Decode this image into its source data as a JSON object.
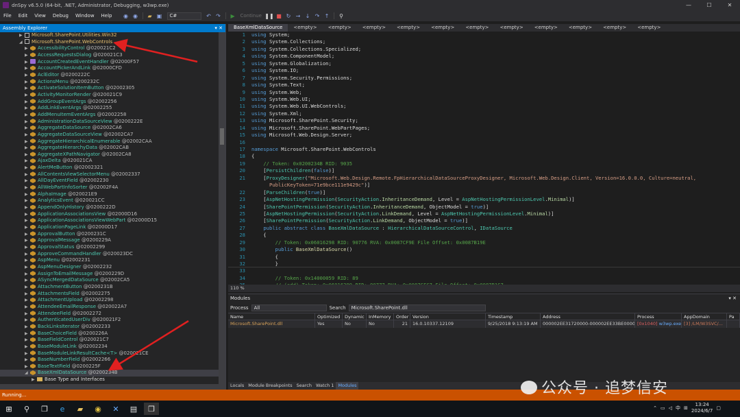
{
  "window": {
    "title": "dnSpy v6.5.0 (64-bit, .NET, Administrator, Debugging, w3wp.exe)"
  },
  "menu": [
    "File",
    "Edit",
    "View",
    "Debug",
    "Window",
    "Help"
  ],
  "toolbar": {
    "language": "C#",
    "continue_label": "Continue"
  },
  "explorer": {
    "header": "Assembly Explorer",
    "items": [
      {
        "kind": "ns",
        "exp": "▶",
        "name": "Microsoft.SharePoint.Utilities.Win32",
        "token": ""
      },
      {
        "kind": "ns",
        "exp": "◢",
        "name": "Microsoft.SharePoint.WebControls",
        "token": ""
      },
      {
        "kind": "class",
        "exp": "▶",
        "name": "AccessibilityControl",
        "token": "@020021C2"
      },
      {
        "kind": "class",
        "exp": "▶",
        "name": "AccessRequestsDialog",
        "token": "@020021C3"
      },
      {
        "kind": "delegate",
        "exp": "▶",
        "name": "AccountCreatedEventHandler",
        "token": "@02000F57"
      },
      {
        "kind": "class",
        "exp": "▶",
        "name": "AccountPickerAndLink",
        "token": "@02000CFD"
      },
      {
        "kind": "class",
        "exp": "▶",
        "name": "AclEditor",
        "token": "@0200222C"
      },
      {
        "kind": "class",
        "exp": "▶",
        "name": "ActionsMenu",
        "token": "@0200232C"
      },
      {
        "kind": "class",
        "exp": "▶",
        "name": "ActivateSolutionItemButton",
        "token": "@02002305"
      },
      {
        "kind": "class",
        "exp": "▶",
        "name": "ActivityMonitorRender",
        "token": "@020021C9"
      },
      {
        "kind": "class",
        "exp": "▶",
        "name": "AddGroupEventArgs",
        "token": "@02002256"
      },
      {
        "kind": "class",
        "exp": "▶",
        "name": "AddLinkEventArgs",
        "token": "@02002255"
      },
      {
        "kind": "class",
        "exp": "▶",
        "name": "AddMenuItemEventArgs",
        "token": "@02002258"
      },
      {
        "kind": "class",
        "exp": "▶",
        "name": "AdministrationDataSourceView",
        "token": "@0200222E"
      },
      {
        "kind": "class",
        "exp": "▶",
        "name": "AggregateDataSource",
        "token": "@02002CA6"
      },
      {
        "kind": "class",
        "exp": "▶",
        "name": "AggregateDataSourceView",
        "token": "@02002CA7"
      },
      {
        "kind": "class",
        "exp": "▶",
        "name": "AggregateHierarchicalEnumerable",
        "token": "@02002CAA"
      },
      {
        "kind": "class",
        "exp": "▶",
        "name": "AggregateHierarchyData",
        "token": "@02002CAB"
      },
      {
        "kind": "class",
        "exp": "▶",
        "name": "AggregateXPathNavigator",
        "token": "@02002CA8"
      },
      {
        "kind": "class",
        "exp": "▶",
        "name": "AjaxDelta",
        "token": "@020021CA"
      },
      {
        "kind": "class",
        "exp": "▶",
        "name": "AlertMeButton",
        "token": "@02002321"
      },
      {
        "kind": "class",
        "exp": "▶",
        "name": "AllContentsViewSelectorMenu",
        "token": "@02002337"
      },
      {
        "kind": "class",
        "exp": "▶",
        "name": "AllDayEventField",
        "token": "@02002230"
      },
      {
        "kind": "class",
        "exp": "▶",
        "name": "AllWebPartInfoSorter",
        "token": "@02002F4A"
      },
      {
        "kind": "class",
        "exp": "▶",
        "name": "AlphaImage",
        "token": "@020021E9"
      },
      {
        "kind": "class",
        "exp": "▶",
        "name": "AnalyticsEvent",
        "token": "@020021CC"
      },
      {
        "kind": "class",
        "exp": "▶",
        "name": "AppendOnlyHistory",
        "token": "@0200222D"
      },
      {
        "kind": "class",
        "exp": "▶",
        "name": "ApplicationAssociationsView",
        "token": "@02000D16"
      },
      {
        "kind": "class",
        "exp": "▶",
        "name": "ApplicationAssociationsViewWebPart",
        "token": "@02000D15"
      },
      {
        "kind": "class",
        "exp": "▶",
        "name": "ApplicationPageLink",
        "token": "@02000D17"
      },
      {
        "kind": "class",
        "exp": "▶",
        "name": "ApprovalButton",
        "token": "@0200231C"
      },
      {
        "kind": "class",
        "exp": "▶",
        "name": "ApprovalMessage",
        "token": "@0200229A"
      },
      {
        "kind": "class",
        "exp": "▶",
        "name": "ApprovalStatus",
        "token": "@02002299"
      },
      {
        "kind": "class",
        "exp": "▶",
        "name": "ApproveCommandHandler",
        "token": "@020023DC"
      },
      {
        "kind": "class",
        "exp": "▶",
        "name": "AspMenu",
        "token": "@02002231"
      },
      {
        "kind": "class",
        "exp": "▶",
        "name": "AspMenuDesigner",
        "token": "@02002232"
      },
      {
        "kind": "class",
        "exp": "▶",
        "name": "AssignToEmailMessage",
        "token": "@0200229D"
      },
      {
        "kind": "class",
        "exp": "▶",
        "name": "ASyncMergedDataSource",
        "token": "@02002CA5"
      },
      {
        "kind": "class",
        "exp": "▶",
        "name": "AttachmentButton",
        "token": "@0200231B"
      },
      {
        "kind": "class",
        "exp": "▶",
        "name": "AttachmentsField",
        "token": "@02002275"
      },
      {
        "kind": "class",
        "exp": "▶",
        "name": "AttachmentUpload",
        "token": "@02002298"
      },
      {
        "kind": "class",
        "exp": "▶",
        "name": "AttendeeEmailResponse",
        "token": "@020022A7"
      },
      {
        "kind": "class",
        "exp": "▶",
        "name": "AttendeeField",
        "token": "@02002272"
      },
      {
        "kind": "class",
        "exp": "▶",
        "name": "AuthenticatedUserDiv",
        "token": "@020021F2"
      },
      {
        "kind": "class",
        "exp": "▶",
        "name": "BackLinksIterator",
        "token": "@02002233"
      },
      {
        "kind": "class",
        "exp": "▶",
        "name": "BaseChoiceField",
        "token": "@0200226A"
      },
      {
        "kind": "class",
        "exp": "▶",
        "name": "BaseFieldControl",
        "token": "@020021C7"
      },
      {
        "kind": "class",
        "exp": "▶",
        "name": "BaseModuleLink",
        "token": "@02002234"
      },
      {
        "kind": "class",
        "exp": "▶",
        "name": "BaseModuleLinkResultCache<T>",
        "token": "@020021CE"
      },
      {
        "kind": "class",
        "exp": "▶",
        "name": "BaseNumberField",
        "token": "@02002266"
      },
      {
        "kind": "class",
        "exp": "▶",
        "name": "BaseTextField",
        "token": "@0200225F"
      },
      {
        "kind": "class",
        "exp": "◢",
        "name": "BaseXmlDataSource",
        "token": "@0200234B"
      },
      {
        "kind": "folder",
        "exp": "▶",
        "name": "Base Type and Interfaces",
        "token": ""
      }
    ]
  },
  "editor": {
    "tabs": [
      "BaseXmlDataSource",
      "<empty>",
      "<empty>",
      "<empty>",
      "<empty>",
      "<empty>",
      "<empty>",
      "<empty>",
      "<empty>",
      "<empty>",
      "<empty>",
      "<empty>"
    ],
    "zoom": "110 %"
  },
  "modules": {
    "title": "Modules",
    "process_label": "Process",
    "process_value": "All",
    "search_label": "Search",
    "search_value": "Microsoft.SharePoint.dll",
    "columns": [
      "Name",
      "Optimized",
      "Dynamic",
      "InMemory",
      "Order",
      "Version",
      "Timestamp",
      "Address",
      "Process",
      "AppDomain",
      "Pa"
    ],
    "row": {
      "name": "Microsoft.SharePoint.dll",
      "optimized": "Yes",
      "dynamic": "No",
      "inmemory": "No",
      "order": "21",
      "version": "16.0.10337.12109",
      "timestamp": "9/25/2018 9:13:19 AM",
      "address": "000002EE31720000-000002EE33BE0000",
      "process": "[0x1040]",
      "process_name": "w3wp.exe",
      "appdomain": "[3] /LM/W3SVC/..."
    }
  },
  "bottom_tabs": [
    "Locals",
    "Module Breakpoints",
    "Search",
    "Watch 1",
    "Modules"
  ],
  "status": {
    "text": "Running..."
  },
  "watermark": {
    "text": "公众号 · 追梦信安"
  },
  "taskbar": {
    "tray_lang": "中",
    "time": "13:24",
    "date": "2024/6/7"
  },
  "colors": {
    "accent": "#007acc",
    "status": "#ca5100",
    "arrow": "#e02020"
  }
}
